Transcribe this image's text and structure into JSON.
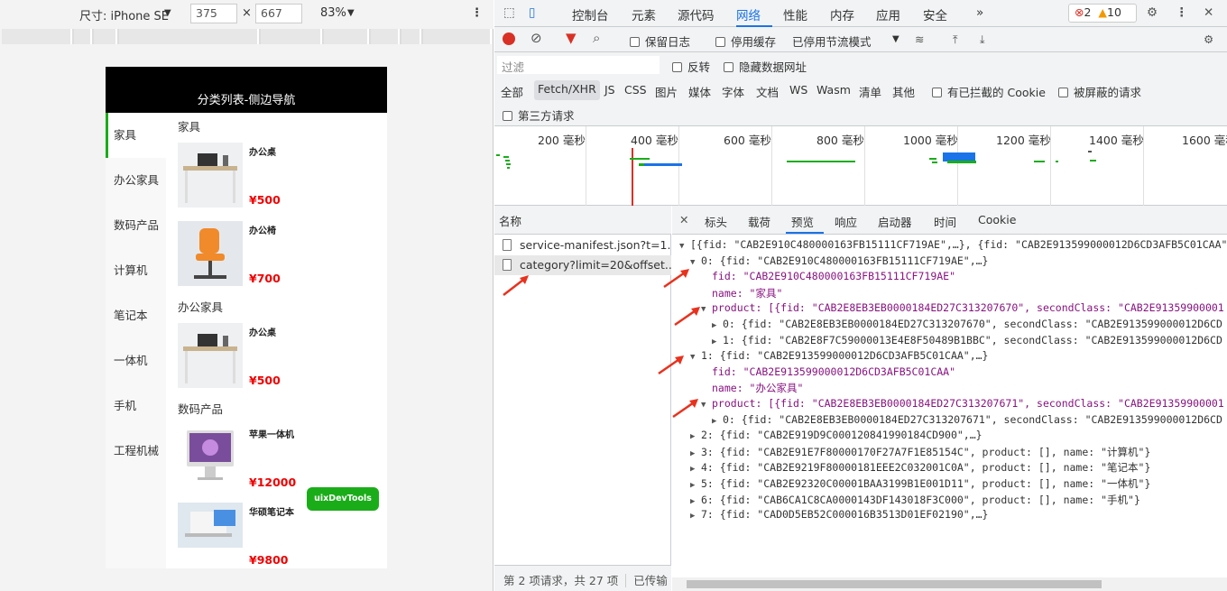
{
  "device_toolbar": {
    "size_label": "尺寸: iPhone SE",
    "width": "375",
    "times": "×",
    "height": "667",
    "zoom": "83%"
  },
  "phone": {
    "title": "分类列表-侧边导航",
    "categories": [
      "家具",
      "办公家具",
      "数码产品",
      "计算机",
      "笔记本",
      "一体机",
      "手机",
      "工程机械"
    ],
    "active_category": 0,
    "sections": [
      {
        "title": "家具",
        "products": [
          {
            "name": "办公桌",
            "price": "¥500"
          },
          {
            "name": "办公椅",
            "price": "¥700"
          }
        ]
      },
      {
        "title": "办公家具",
        "products": [
          {
            "name": "办公桌",
            "price": "¥500"
          }
        ]
      },
      {
        "title": "数码产品",
        "products": [
          {
            "name": "苹果一体机",
            "price": "¥12000"
          },
          {
            "name": "华硕笔记本",
            "price": "¥9800"
          }
        ]
      }
    ],
    "uix_button": "uixDevTools"
  },
  "devtools": {
    "tabs": [
      "控制台",
      "元素",
      "源代码",
      "网络",
      "性能",
      "内存",
      "应用",
      "安全"
    ],
    "active_tab": "网络",
    "more": "»",
    "errors": "2",
    "warnings": "10",
    "toolbar": {
      "preserve_log": "保留日志",
      "disable_cache": "停用缓存",
      "throttle": "已停用节流模式"
    },
    "filter": {
      "placeholder": "过滤",
      "invert": "反转",
      "hide_data_urls": "隐藏数据网址"
    },
    "types": [
      "全部",
      "Fetch/XHR",
      "JS",
      "CSS",
      "图片",
      "媒体",
      "字体",
      "文档",
      "WS",
      "Wasm",
      "清单",
      "其他"
    ],
    "blocked_cookies": "有已拦截的 Cookie",
    "blocked_requests": "被屏蔽的请求",
    "third_party": "第三方请求",
    "timeline_ticks": [
      "200 毫秒",
      "400 毫秒",
      "600 毫秒",
      "800 毫秒",
      "1000 毫秒",
      "1200 毫秒",
      "1400 毫秒",
      "1600 毫秒"
    ],
    "name_header": "名称",
    "requests": [
      "service-manifest.json?t=1...",
      "category?limit=20&offset..."
    ],
    "footer": "第 2 项请求，共 27 项",
    "footer2": "已传输",
    "detail_tabs": [
      "标头",
      "载荷",
      "预览",
      "响应",
      "启动器",
      "时间",
      "Cookie"
    ],
    "active_detail_tab": "预览",
    "preview_lines": [
      "[{fid: \"CAB2E910C480000163FB15111CF719AE\",…}, {fid: \"CAB2E913599000012D6CD3AFB5C01CAA\"",
      "0: {fid: \"CAB2E910C480000163FB15111CF719AE\",…}",
      "fid: \"CAB2E910C480000163FB15111CF719AE\"",
      "name: \"家具\"",
      "product: [{fid: \"CAB2E8EB3EB0000184ED27C313207670\", secondClass: \"CAB2E91359900001",
      "0: {fid: \"CAB2E8EB3EB0000184ED27C313207670\", secondClass: \"CAB2E913599000012D6CD",
      "1: {fid: \"CAB2E8F7C59000013E4E8F50489B1BBC\", secondClass: \"CAB2E913599000012D6CD",
      "1: {fid: \"CAB2E913599000012D6CD3AFB5C01CAA\",…}",
      "fid: \"CAB2E913599000012D6CD3AFB5C01CAA\"",
      "name: \"办公家具\"",
      "product: [{fid: \"CAB2E8EB3EB0000184ED27C313207671\", secondClass: \"CAB2E91359900001",
      "0: {fid: \"CAB2E8EB3EB0000184ED27C313207671\", secondClass: \"CAB2E913599000012D6CD",
      "2: {fid: \"CAB2E919D9C000120841990184CD900\",…}",
      "3: {fid: \"CAB2E91E7F80000170F27A7F1E85154C\", product: [], name: \"计算机\"}",
      "4: {fid: \"CAB2E9219F80000181EEE2C032001C0A\", product: [], name: \"笔记本\"}",
      "5: {fid: \"CAB2E92320C00001BAA3199B1E001D11\", product: [], name: \"一体机\"}",
      "6: {fid: \"CAB6CA1C8CA0000143DF143018F3C000\", product: [], name: \"手机\"}",
      "7: {fid: \"CAD0D5EB52C000016B3513D01EF02190\",…}"
    ],
    "colors": {
      "accent": "#1a73e8",
      "string": "#c41a16",
      "key": "#881280",
      "arrow": "#e8321e"
    }
  }
}
